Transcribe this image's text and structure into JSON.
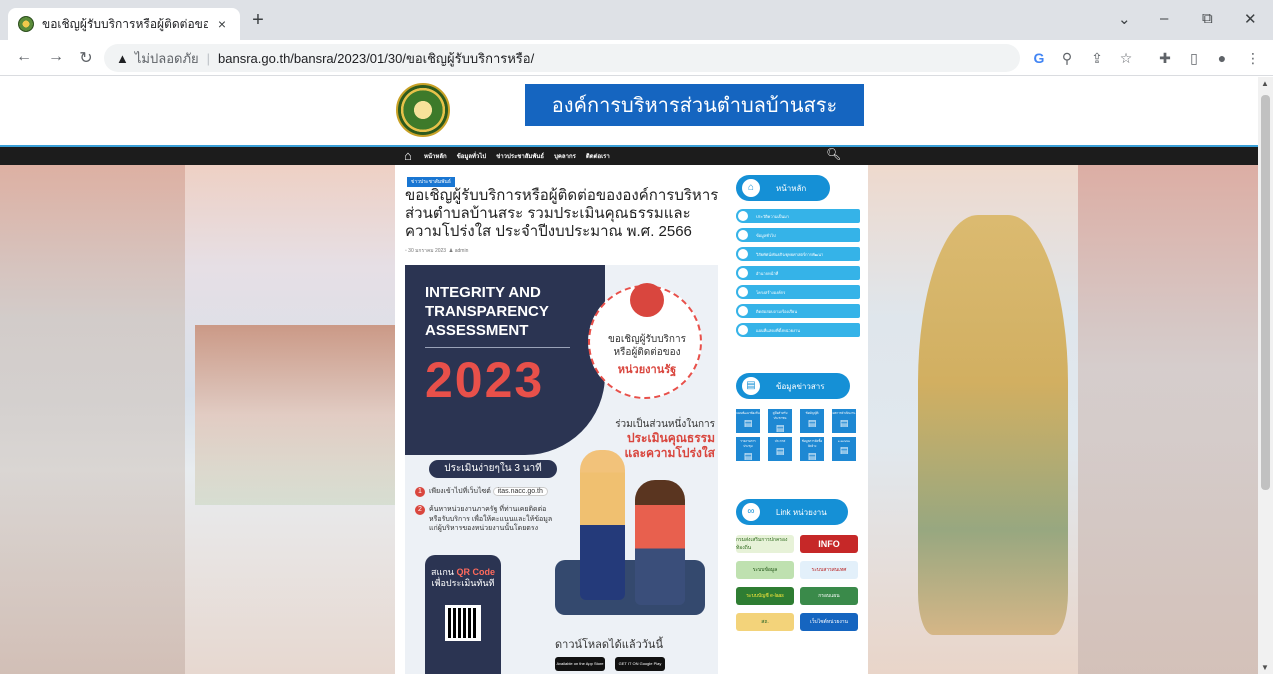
{
  "browser": {
    "tab_title": "ขอเชิญผู้รับบริการหรือผู้ติดต่อขององค์",
    "tab_close": "×",
    "new_tab": "+",
    "win_min": "–",
    "win_restore": "⧉",
    "win_close": "✕",
    "win_dropdown": "⌄",
    "security_label": "ไม่ปลอดภัย",
    "url": "bansra.go.th/bansra/2023/01/30/ขอเชิญผู้รับบริการหรือ/"
  },
  "site": {
    "banner_title": "องค์การบริหารส่วนตำบลบ้านสระ",
    "nav": [
      "หน้าหลัก",
      "ข้อมูลทั่วไป",
      "ข่าวประชาสัมพันธ์",
      "บุคลากร",
      "ติดต่อเรา"
    ]
  },
  "post": {
    "category": "ข่าวประชาสัมพันธ์",
    "title": "ขอเชิญผู้รับบริการหรือผู้ติดต่อขององค์การบริหารส่วนตำบลบ้านสระ รวมประเมินคุณธรรมและความโปร่งใส ประจำปีงบประมาณ พ.ศ. 2566",
    "date": "30 มกราคม 2023",
    "author": "admin"
  },
  "poster": {
    "heading_line1": "INTEGRITY AND",
    "heading_line2": "TRANSPARENCY",
    "heading_line3": "ASSESSMENT",
    "year": "2023",
    "invite_line1": "ขอเชิญผู้รับบริการ",
    "invite_line2": "หรือผู้ติดต่อของ",
    "invite_line3": "หน่วยงานรัฐ",
    "part_of": "ร่วมเป็นส่วนหนึ่งในการ",
    "ethics_line1": "ประเมินคุณธรรม",
    "ethics_line2": "และความโปร่งใส",
    "pill": "ประเมินง่ายๆใน 3 นาที",
    "step1": "เพียงเข้าไปที่เว็บไซต์",
    "step1_url": "itas.nacc.go.th",
    "step2_line1": "ค้นหาหน่วยงานภาครัฐ ที่ท่านเคยติดต่อ",
    "step2_line2": "หรือรับบริการ เพื่อให้คะแนนและให้ข้อมูล",
    "step2_line3": "แก่ผู้บริหารของหน่วยงานนั้นโดยตรง",
    "qr_line1": "สแกน",
    "qr_highlight": "QR Code",
    "qr_line2": "เพื่อประเมินทันที",
    "download": "ดาวน์โหลดได้แล้ววันนี้",
    "store1": "Available on the App Store",
    "store2": "GET IT ON Google Play"
  },
  "sidebar": {
    "home_head": "หน้าหลัก",
    "home_items": [
      "ประวัติความเป็นมา",
      "ข้อมูลทั่วไป",
      "วิสัยทัศน์/พันธกิจ/ยุทธศาสตร์การพัฒนา",
      "อำนาจหน้าที่",
      "โครงสร้างองค์กร",
      "ติดต่อสอบถาม/ร้องเรียน",
      "แผนที่แสดงที่ตั้งหน่วยงาน"
    ],
    "info_head": "ข้อมูลข่าวสาร",
    "info_grid": [
      "แผนพัฒนาท้องถิ่น",
      "คู่มือสำหรับประชาชน",
      "ข้อบัญญัติ",
      "ผลการดำเนินงาน",
      "รายงานการประชุม",
      "ประกาศ",
      "ข้อมูลการจัดซื้อจัดจ้าง",
      "e-service"
    ],
    "links_head": "Link หน่วยงาน",
    "links": [
      "กรมส่งเสริมการปกครองท้องถิ่น",
      "INFO",
      "ระบบข้อมูล",
      "ระบบสารสนเทศ",
      "ระบบบัญชี e-laas",
      "กรอบแผน",
      "สถ.",
      "เว็บไซต์หน่วยงาน"
    ]
  }
}
